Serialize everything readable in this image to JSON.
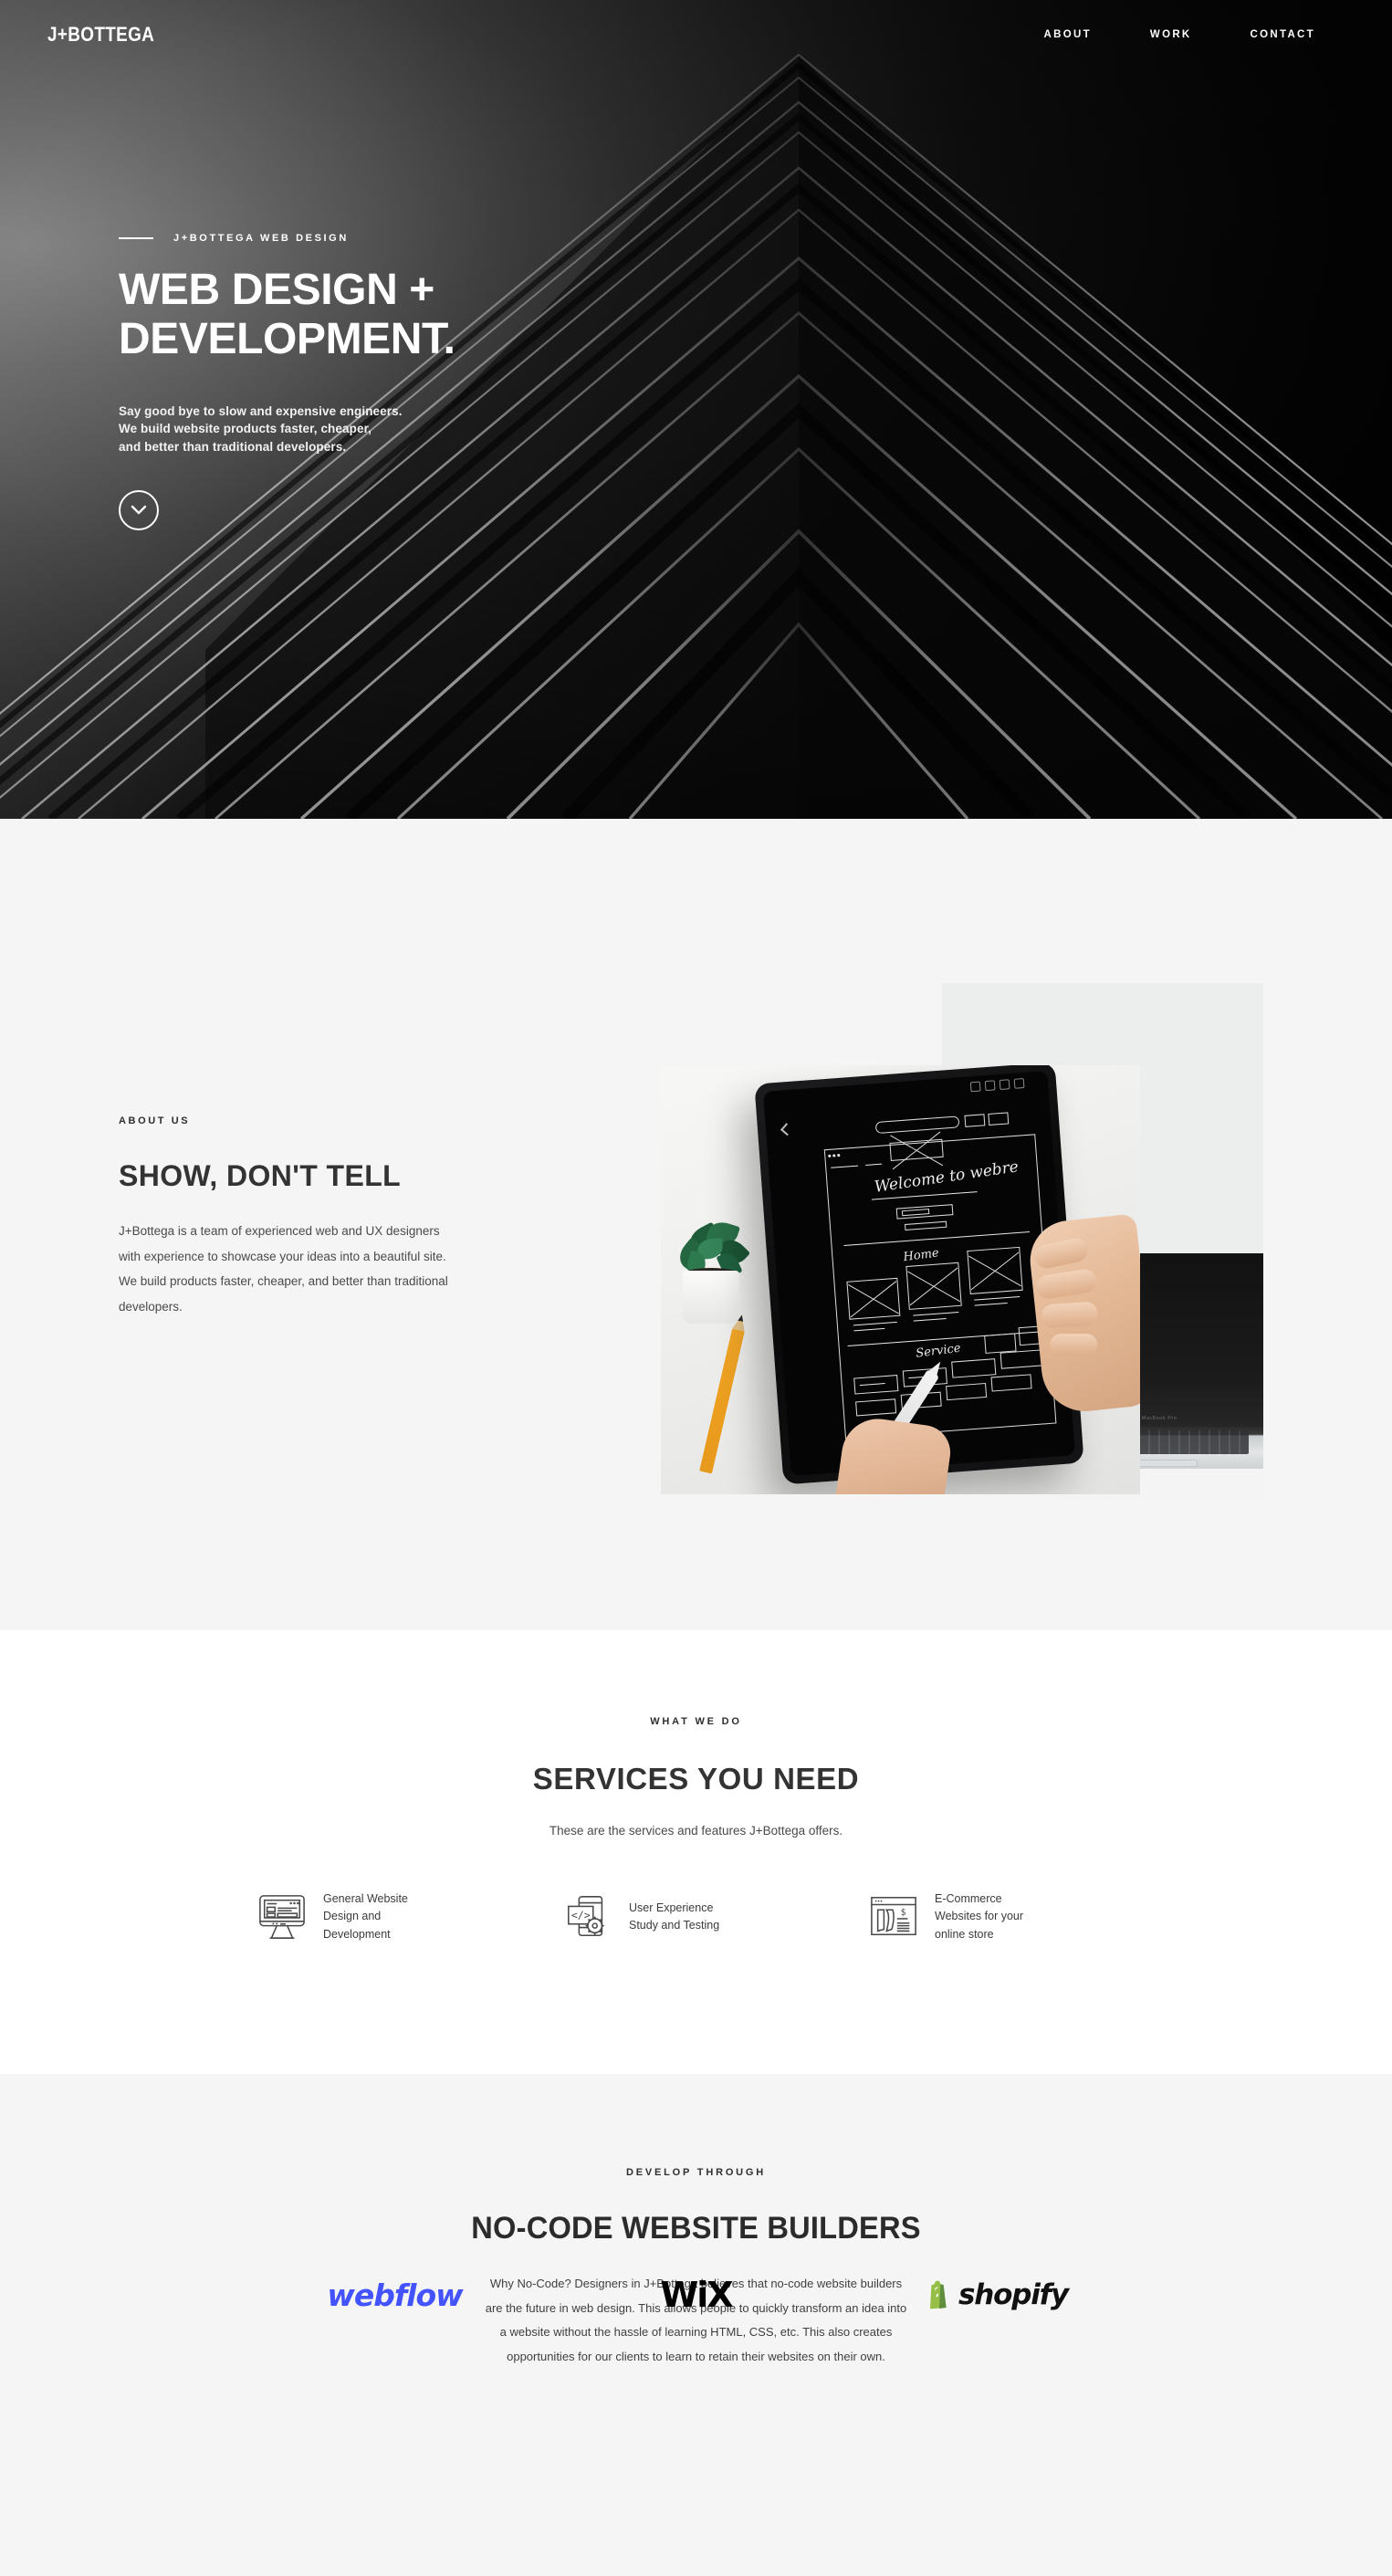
{
  "nav": {
    "logo": "J+BOTTEGA",
    "links": [
      {
        "label": "ABOUT"
      },
      {
        "label": "WORK"
      },
      {
        "label": "CONTACT"
      }
    ]
  },
  "hero": {
    "eyebrow": "J+BOTTEGA WEB DESIGN",
    "title_line1": "WEB DESIGN +",
    "title_line2": "DEVELOPMENT.",
    "sub_line1": "Say good bye to slow and expensive engineers.",
    "sub_line2": "We build website products faster, cheaper,",
    "sub_line3": "and better than traditional developers.",
    "scroll_icon": "chevron-down-icon",
    "background": "#0b0b0b"
  },
  "about": {
    "kicker": "ABOUT US",
    "heading": "SHOW, DON'T TELL",
    "paragraph_line1": "J+Bottega is a team of experienced web and UX designers",
    "paragraph_line2": "with experience to showcase your ideas into a beautiful site.",
    "paragraph_line3": "We build products faster, cheaper, and better than traditional",
    "paragraph_line4": "developers.",
    "background": "#f5f5f5",
    "image_alt": "hand-holding-tablet-with-wireframe-sketch",
    "tablet_text_welcome": "Welcome to webre",
    "tablet_text_home": "Home",
    "tablet_text_service": "Service"
  },
  "services": {
    "kicker": "WHAT WE DO",
    "heading": "SERVICES YOU NEED",
    "subheading": "These are the services and features J+Bottega offers.",
    "background": "#ffffff",
    "items": [
      {
        "icon": "desktop-monitor-icon",
        "line1": "General Website",
        "line2": "Design and",
        "line3": "Development"
      },
      {
        "icon": "mobile-code-gear-icon",
        "line1": "User Experience",
        "line2": "Study and Testing",
        "line3": ""
      },
      {
        "icon": "ecommerce-browser-icon",
        "line1": "E-Commerce",
        "line2": "Websites for your",
        "line3": "online store"
      }
    ]
  },
  "nocode": {
    "kicker": "DEVELOP THROUGH",
    "heading": "NO-CODE WEBSITE BUILDERS",
    "paragraph_line1": "Why No-Code? Designers in J+Bottega believes that no-code website builders",
    "paragraph_line2": "are the future in web design. This allows people to quickly transform an idea into",
    "paragraph_line3": "a website without the hassle of learning HTML, CSS, etc. This also creates",
    "paragraph_line4": "opportunities for our clients to learn to retain their websites on their own.",
    "background": "#f5f5f5",
    "logos": [
      {
        "name": "webflow",
        "label": "webflow",
        "color": "#4353ff"
      },
      {
        "name": "wix",
        "label": "WiX",
        "color": "#000000"
      },
      {
        "name": "shopify",
        "label": "shopify",
        "color": "#95bf47"
      }
    ]
  }
}
